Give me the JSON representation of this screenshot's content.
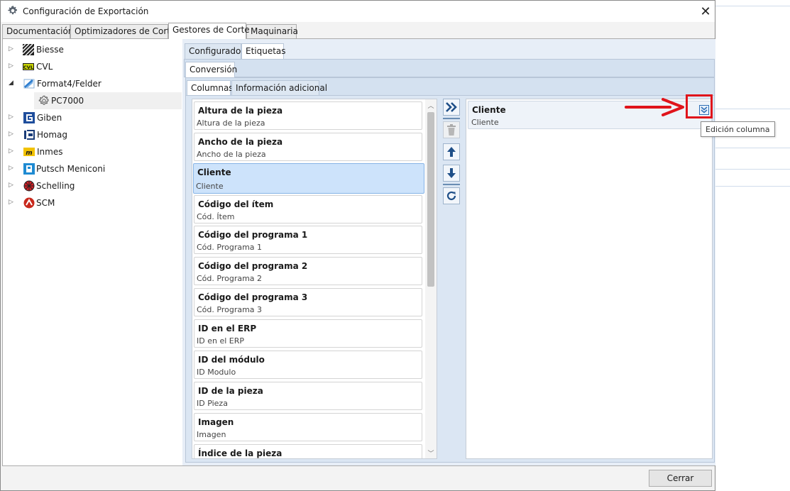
{
  "window": {
    "title": "Configuración de Exportación",
    "close_glyph": "✕"
  },
  "top_tabs": [
    {
      "label": "Documentación"
    },
    {
      "label": "Optimizadores de Corte"
    },
    {
      "label": "Gestores de Corte",
      "active": true
    },
    {
      "label": "Maquinaria"
    }
  ],
  "tree": {
    "items": [
      {
        "label": "Biesse",
        "icon": "biesse-logo-icon",
        "expanded": false
      },
      {
        "label": "CVL",
        "icon": "cvl-logo-icon",
        "expanded": false
      },
      {
        "label": "Format4/Felder",
        "icon": "format4-logo-icon",
        "expanded": true
      },
      {
        "label": "PC7000",
        "icon": "gear-icon",
        "child": true,
        "selected": true
      },
      {
        "label": "Giben",
        "icon": "giben-logo-icon",
        "expanded": false
      },
      {
        "label": "Homag",
        "icon": "homag-logo-icon",
        "expanded": false
      },
      {
        "label": "Inmes",
        "icon": "inmes-logo-icon",
        "expanded": false
      },
      {
        "label": "Putsch Meniconi",
        "icon": "putsch-logo-icon",
        "expanded": false
      },
      {
        "label": "Schelling",
        "icon": "schelling-logo-icon",
        "expanded": false
      },
      {
        "label": "SCM",
        "icon": "scm-logo-icon",
        "expanded": false
      }
    ]
  },
  "panel_tabs": {
    "level1": [
      {
        "label": "Configurador"
      },
      {
        "label": "Etiquetas",
        "active": true
      }
    ],
    "level2": [
      {
        "label": "Conversión",
        "active": true
      }
    ],
    "level3": [
      {
        "label": "Columnas",
        "active": true
      },
      {
        "label": "Información adicional"
      }
    ]
  },
  "available_columns": [
    {
      "title": "Altura de la pieza",
      "subtitle": "Altura de la pieza"
    },
    {
      "title": "Ancho de la pieza",
      "subtitle": "Ancho de la pieza"
    },
    {
      "title": "Cliente",
      "subtitle": "Cliente",
      "selected": true
    },
    {
      "title": "Código del ítem",
      "subtitle": "Cód. Ítem"
    },
    {
      "title": "Código del programa 1",
      "subtitle": "Cód. Programa 1"
    },
    {
      "title": "Código del programa 2",
      "subtitle": "Cód. Programa 2"
    },
    {
      "title": "Código del programa 3",
      "subtitle": "Cód. Programa 3"
    },
    {
      "title": "ID en el ERP",
      "subtitle": "ID en el ERP"
    },
    {
      "title": "ID del módulo",
      "subtitle": "ID Modulo"
    },
    {
      "title": "ID de la pieza",
      "subtitle": "ID Pieza"
    },
    {
      "title": "Imagen",
      "subtitle": "Imagen"
    },
    {
      "title": "Índice de la pieza",
      "subtitle": ""
    }
  ],
  "selected_columns": [
    {
      "title": "Cliente",
      "subtitle": "Cliente"
    }
  ],
  "tooltip": "Edición columna",
  "footer": {
    "close_label": "Cerrar"
  },
  "colors": {
    "highlight": "#e0141b",
    "accent": "#2f6fb5",
    "selection": "#cde3fb"
  }
}
